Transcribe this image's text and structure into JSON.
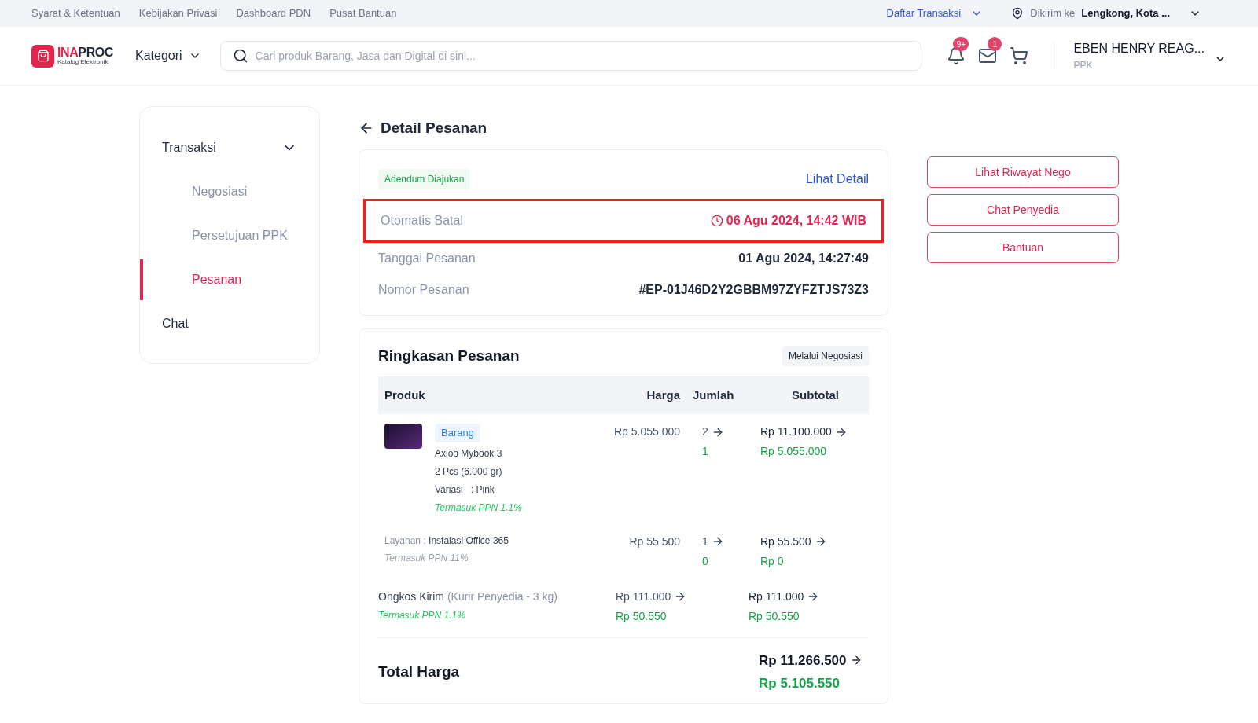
{
  "top_bar": {
    "links": [
      "Syarat & Ketentuan",
      "Kebijakan Privasi",
      "Dashboard PDN",
      "Pusat Bantuan"
    ],
    "transactions_menu": "Daftar Transaksi",
    "ship_to_label": "Dikirim ke",
    "ship_to_value": "Lengkong, Kota ..."
  },
  "header": {
    "logo": {
      "wordmark_parts": [
        "INA",
        "PROC"
      ],
      "subtitle": "Katalog Elektronik"
    },
    "category_menu": "Kategori",
    "search": {
      "placeholder": "Cari produk Barang, Jasa dan Digital di sini..."
    },
    "notification_count": "9+",
    "message_count": "1",
    "user": {
      "name": "EBEN HENRY REAG...",
      "role": "PPK"
    }
  },
  "sidebar": {
    "items": [
      {
        "label": "Transaksi",
        "expanded": true,
        "children": [
          {
            "label": "Negosiasi",
            "selected": false
          },
          {
            "label": "Persetujuan PPK",
            "selected": false
          },
          {
            "label": "Pesanan",
            "selected": true
          }
        ]
      },
      {
        "label": "Chat"
      }
    ]
  },
  "page_title": "Detail Pesanan",
  "order_info": {
    "status_badge": "Adendum Diajukan",
    "detail_link": "Lihat Detail",
    "rows": [
      {
        "label": "Otomatis Batal",
        "value": "06 Agu 2024, 14:42 WIB",
        "kind": "deadline",
        "highlighted": true
      },
      {
        "label": "Tanggal Pesanan",
        "value": "01 Agu 2024, 14:27:49",
        "kind": "plain",
        "highlighted": false
      },
      {
        "label": "Nomor Pesanan",
        "value": "#EP-01J46D2Y2GBBM97ZYFZTJS73Z3",
        "kind": "plain",
        "highlighted": false
      }
    ]
  },
  "summary": {
    "title": "Ringkasan Pesanan",
    "method_badge": "Melalui Negosiasi",
    "columns": [
      "Produk",
      "Harga",
      "Jumlah",
      "Subtotal"
    ],
    "items": [
      {
        "kind": "product",
        "badge": "Barang",
        "name": "Axioo Mybook 3",
        "quantity_weight": "2 Pcs (6.000 gr)",
        "variation": "Variasi   : Pink",
        "tax_note": "Termasuk PPN 1.1%",
        "price": "Rp 5.055.000",
        "qty_old": "2",
        "qty_new": "1",
        "subtotal_old": "Rp 11.100.000",
        "subtotal_new": "Rp 5.055.000"
      },
      {
        "kind": "service",
        "label": "Layanan :",
        "name": "Instalasi Office 365",
        "tax_note": "Termasuk PPN 11%",
        "price": "Rp 55.500",
        "qty_old": "1",
        "qty_new": "0",
        "subtotal_old": "Rp 55.500",
        "subtotal_new": "Rp 0"
      }
    ],
    "shipping": {
      "label": "Ongkos Kirim",
      "detail": "(Kurir Penyedia - 3 kg)",
      "tax_note": "Termasuk PPN 1.1%",
      "price_old": "Rp 111.000",
      "price_new": "Rp 50.550",
      "subtotal_old": "Rp 111.000",
      "subtotal_new": "Rp 50.550"
    },
    "total": {
      "label": "Total Harga",
      "old": "Rp 11.266.500",
      "new": "Rp 5.105.550"
    }
  },
  "actions": [
    "Lihat Riwayat Nego",
    "Chat Penyedia",
    "Bantuan"
  ]
}
